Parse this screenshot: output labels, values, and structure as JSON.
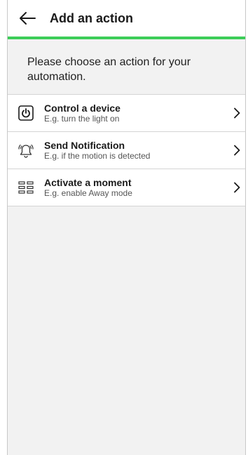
{
  "header": {
    "title": "Add an action",
    "back_icon": "arrow-left-icon",
    "accent_color": "#3dcd58"
  },
  "intro": {
    "text": "Please choose an action for your automation."
  },
  "actions": [
    {
      "title": "Control a device",
      "subtitle": "E.g. turn the light on",
      "icon": "power-icon"
    },
    {
      "title": "Send Notification",
      "subtitle": "E.g. if the motion is detected",
      "icon": "bell-ringing-icon"
    },
    {
      "title": "Activate a moment",
      "subtitle": "E.g. enable Away mode",
      "icon": "grid-icon"
    }
  ]
}
